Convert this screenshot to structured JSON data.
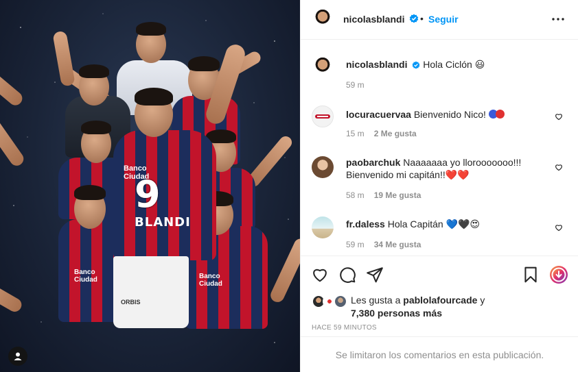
{
  "post": {
    "author": "nicolasblandi",
    "follow_label": "Seguir",
    "more_icon": "more-horizontal-icon",
    "image": {
      "jersey_number": "9",
      "jersey_name": "BLANDI",
      "sponsor": "Banco Ciudad",
      "sponsor_short": "Banco Ciudad",
      "shorts_brand": "ORBIS"
    },
    "caption": {
      "username": "nicolasblandi",
      "text": "Hola Ciclón 😃",
      "time": "59 m"
    }
  },
  "comments": [
    {
      "username": "locuracuervaa",
      "text": "Bienvenido Nico!",
      "time": "15 m",
      "likes": "2 Me gusta"
    },
    {
      "username": "paobarchuk",
      "text": "Naaaaaaa yo llorooooooo!!! Bienvenido mi capitán!!❤️❤️",
      "time": "58 m",
      "likes": "19 Me gusta"
    },
    {
      "username": "fr.daless",
      "text": "Hola Capitán 💙🖤😍",
      "time": "59 m",
      "likes": "34 Me gusta"
    }
  ],
  "actions": {
    "like_icon": "heart-outline-icon",
    "comment_icon": "comment-bubble-icon",
    "share_icon": "send-paper-plane-icon",
    "save_icon": "bookmark-icon",
    "extra_icon": "download-badge-icon"
  },
  "likes": {
    "prefix": "Les gusta a",
    "user": "pablolafourcade",
    "suffix": "y",
    "others": "7,380 personas más"
  },
  "time_ago": "HACE 59 MINUTOS",
  "comments_limited": "Se limitaron los comentarios en esta publicación.",
  "colors": {
    "link_blue": "#0095f6",
    "verified_blue": "#0095f6",
    "muted": "#8e8e8e",
    "jersey_blue": "#1c2d5c",
    "jersey_red": "#c2142b"
  }
}
